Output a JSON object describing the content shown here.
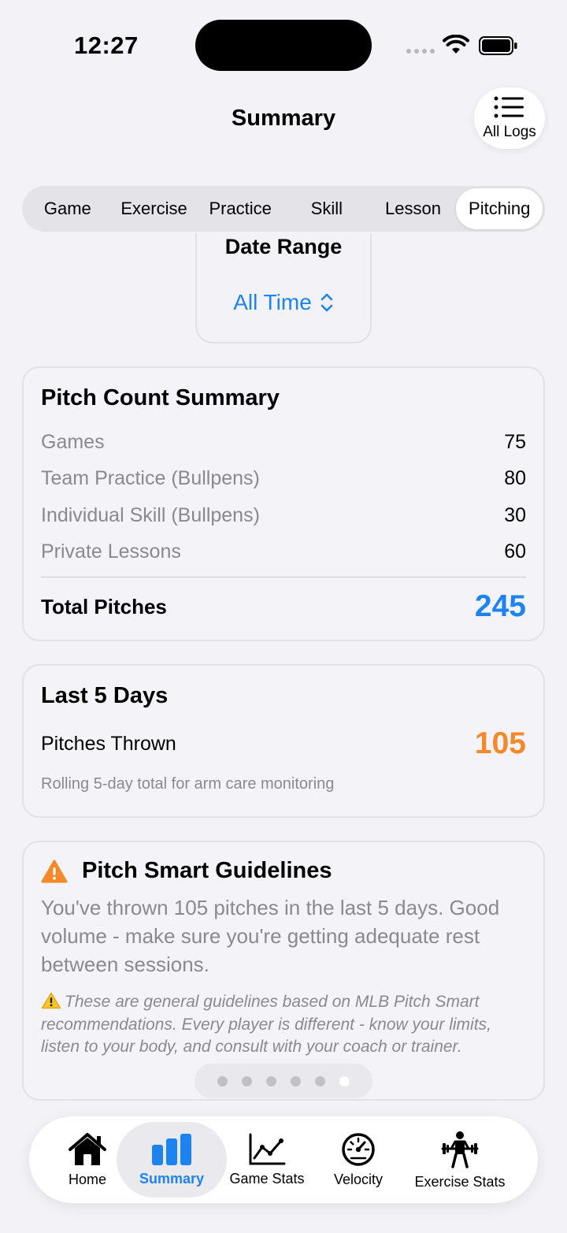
{
  "status": {
    "time": "12:27"
  },
  "nav": {
    "title": "Summary",
    "all_logs_label": "All Logs"
  },
  "segments": [
    {
      "label": "Game",
      "active": false
    },
    {
      "label": "Exercise",
      "active": false
    },
    {
      "label": "Practice",
      "active": false
    },
    {
      "label": "Skill",
      "active": false
    },
    {
      "label": "Lesson",
      "active": false
    },
    {
      "label": "Pitching",
      "active": true
    }
  ],
  "date_range": {
    "title": "Date Range",
    "value": "All Time"
  },
  "pitch_count_summary": {
    "title": "Pitch Count Summary",
    "rows": [
      {
        "label": "Games",
        "value": "75"
      },
      {
        "label": "Team Practice (Bullpens)",
        "value": "80"
      },
      {
        "label": "Individual Skill (Bullpens)",
        "value": "30"
      },
      {
        "label": "Private Lessons",
        "value": "60"
      }
    ],
    "total_label": "Total Pitches",
    "total_value": "245"
  },
  "last_5_days": {
    "title": "Last 5 Days",
    "label": "Pitches Thrown",
    "value": "105",
    "note": "Rolling 5-day total for arm care monitoring"
  },
  "pitch_smart": {
    "title": "Pitch Smart Guidelines",
    "body": "You've thrown 105 pitches in the last 5 days. Good volume - make sure you're getting adequate rest between sessions.",
    "disclaimer": "These are general guidelines based on MLB Pitch Smart recommendations. Every player is different - know your limits, listen to your body, and consult with your coach or trainer."
  },
  "page_indicator": {
    "count": 6,
    "current": 6
  },
  "tabs": [
    {
      "label": "Home",
      "icon": "house-icon",
      "active": false
    },
    {
      "label": "Summary",
      "icon": "bar-chart-icon",
      "active": true
    },
    {
      "label": "Game Stats",
      "icon": "line-chart-icon",
      "active": false
    },
    {
      "label": "Velocity",
      "icon": "gauge-icon",
      "active": false
    },
    {
      "label": "Exercise Stats",
      "icon": "weightlifter-icon",
      "active": false
    }
  ],
  "colors": {
    "accent": "#1d83f0",
    "orange": "#f5892a",
    "background": "#f2f2f7"
  }
}
